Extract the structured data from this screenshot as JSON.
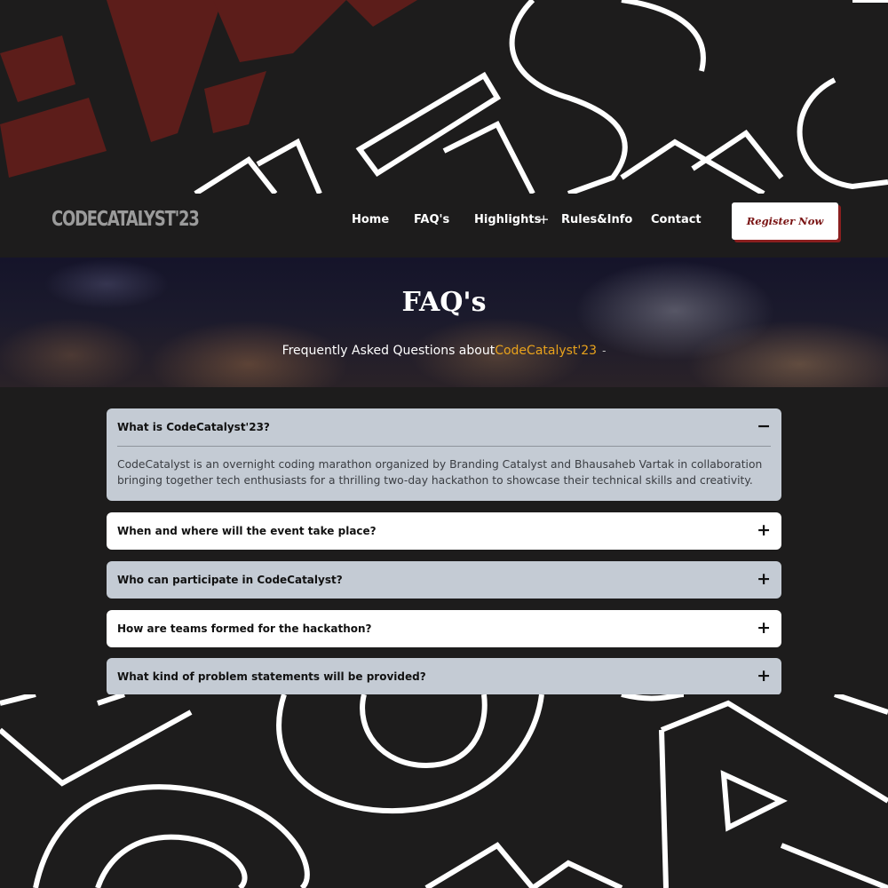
{
  "brand": {
    "logo": "CODECATALYST'23"
  },
  "nav": {
    "items": [
      {
        "label": "Home"
      },
      {
        "label": "FAQ's"
      },
      {
        "label": "Highlights"
      },
      {
        "label": "Rules&Info"
      },
      {
        "label": "Contact"
      }
    ],
    "highlights_expand": "+",
    "register_label": "Register Now"
  },
  "hero": {
    "title": "FAQ's",
    "subtitle_prefix": "Frequently Asked Questions about",
    "subtitle_accent": "CodeCatalyst'23",
    "subtitle_suffix": "-"
  },
  "faq": {
    "items": [
      {
        "question": "What is CodeCatalyst'23?",
        "expanded": true,
        "toggle": "−",
        "answer": "CodeCatalyst is an overnight coding marathon organized by Branding Catalyst and Bhausaheb Vartak in collaboration bringing together tech enthusiasts for a thrilling two-day hackathon to showcase their technical skills and creativity."
      },
      {
        "question": "When and where will the event take place?",
        "expanded": false,
        "toggle": "+"
      },
      {
        "question": "Who can participate in CodeCatalyst?",
        "expanded": false,
        "toggle": "+"
      },
      {
        "question": "How are teams formed for the hackathon?",
        "expanded": false,
        "toggle": "+"
      },
      {
        "question": "What kind of problem statements will be provided?",
        "expanded": false,
        "toggle": "+"
      }
    ]
  },
  "colors": {
    "background": "#1d1c1c",
    "accent": "#e8a21c",
    "brand_red": "#7a1414",
    "faq_light": "#ffffff",
    "faq_gray": "#c4cbd4"
  }
}
